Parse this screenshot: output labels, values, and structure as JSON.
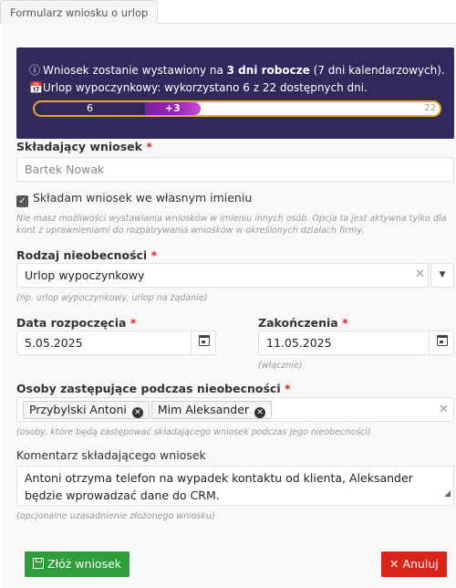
{
  "tab": {
    "label": "Formularz wniosku o urlop"
  },
  "info": {
    "line1_pre": "Wniosek zostanie wystawiony na ",
    "line1_bold": "3 dni robocze",
    "line1_post": " (7 dni kalendarzowych).",
    "line2": "Urlop wypoczynkowy: wykorzystano 6 z 22 dostępnych dni.",
    "info_icon": "info-circle-icon",
    "calendar_icon": "calendar-icon"
  },
  "progress": {
    "used": 6,
    "new": 3,
    "total": 22,
    "used_label": "6",
    "new_label": "+3",
    "total_label": "22"
  },
  "applicant": {
    "label": "Składający wniosek",
    "required": "*",
    "value": "Bartek Nowak"
  },
  "own_name": {
    "label": "Składam wniosek we własnym imieniu",
    "checked": true,
    "hint": "Nie masz możliwości wystawiania wniosków w imieniu innych osób. Opcja ta jest aktywna tylko dla kont z uprawnieniami do rozpatrywania wniosków w określonych działach firmy."
  },
  "absence_type": {
    "label": "Rodzaj nieobecności",
    "required": "*",
    "value": "Urlop wypoczynkowy",
    "hint": "(np. urlop wypoczynkowy, urlop na żądanie)"
  },
  "start_date": {
    "label": "Data rozpoczęcia",
    "required": "*",
    "value": "5.05.2025"
  },
  "end_date": {
    "label": "Zakończenia",
    "required": "*",
    "value": "11.05.2025",
    "hint": "(włącznie)"
  },
  "substitutes": {
    "label": "Osoby zastępujące podczas nieobecności",
    "required": "*",
    "tags": [
      "Przybylski Antoni",
      "Mim Aleksander"
    ],
    "hint": "(osoby, które będą zastępować składającego wniosek podczas jego nieobecności)"
  },
  "comment": {
    "label": "Komentarz składającego wniosek",
    "value": "Antoni otrzyma telefon na wypadek kontaktu od klienta, Aleksander będzie wprowadzać dane do CRM.",
    "hint": "(opcjonalne uzasadnienie złożonego wniosku)"
  },
  "buttons": {
    "submit": "Złóż wniosek",
    "cancel": "Anuluj"
  },
  "colors": {
    "info_bg": "#2f2a5b",
    "accent": "#9b27b8",
    "submit": "#2e9e3a",
    "cancel": "#d9241c",
    "required": "#d9241c"
  }
}
